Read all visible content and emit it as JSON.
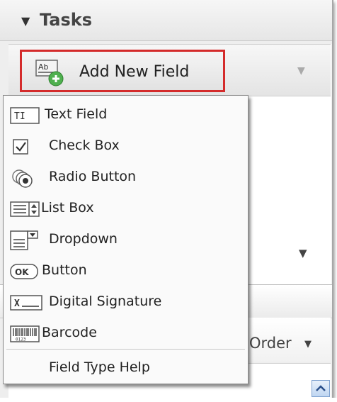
{
  "tasks": {
    "title": "Tasks"
  },
  "add_field": {
    "label": "Add New Field",
    "icon_text": "Ab"
  },
  "order": {
    "label": "Order"
  },
  "menu": {
    "items": [
      {
        "label": "Text Field",
        "icon": "text-field-icon",
        "icon_text": "TI"
      },
      {
        "label": "Check Box",
        "icon": "checkbox-icon"
      },
      {
        "label": "Radio Button",
        "icon": "radio-button-icon"
      },
      {
        "label": "List Box",
        "icon": "list-box-icon"
      },
      {
        "label": "Dropdown",
        "icon": "dropdown-icon"
      },
      {
        "label": "Button",
        "icon": "button-icon",
        "icon_text": "OK"
      },
      {
        "label": "Digital Signature",
        "icon": "digital-signature-icon",
        "icon_text": "X"
      },
      {
        "label": "Barcode",
        "icon": "barcode-icon",
        "icon_text": "0123"
      }
    ],
    "help_label": "Field Type Help"
  },
  "colors": {
    "highlight_border": "#d42b2b",
    "panel": "#eeeeee"
  }
}
